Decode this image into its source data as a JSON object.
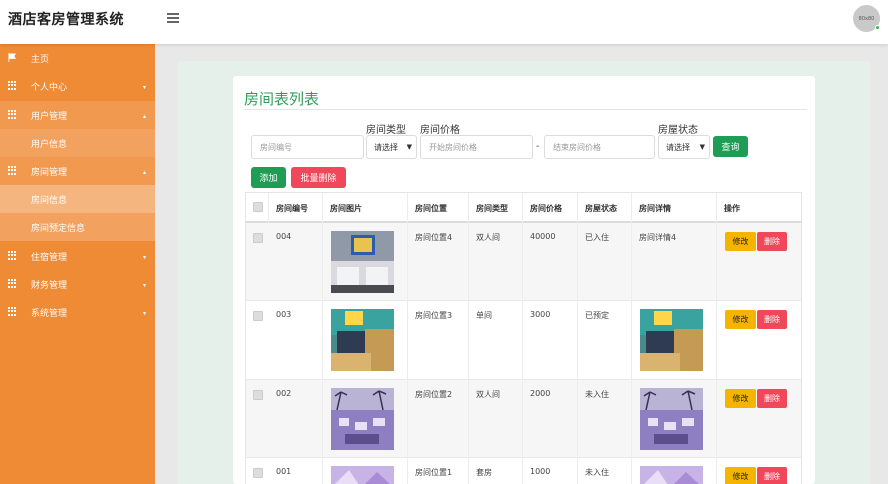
{
  "header": {
    "app_title": "酒店客房管理系统",
    "avatar_text": "80x80"
  },
  "sidebar": {
    "items": [
      {
        "label": "主页",
        "icon": "flag-icon"
      },
      {
        "label": "个人中心",
        "icon": "grid-icon"
      },
      {
        "label": "用户管理",
        "icon": "grid-icon"
      },
      {
        "label": "用户信息"
      },
      {
        "label": "房间管理",
        "icon": "grid-icon"
      },
      {
        "label": "房间信息"
      },
      {
        "label": "房间预定信息"
      },
      {
        "label": "住宿管理",
        "icon": "grid-icon"
      },
      {
        "label": "财务管理",
        "icon": "grid-icon"
      },
      {
        "label": "系统管理",
        "icon": "grid-icon"
      }
    ]
  },
  "panel": {
    "title": "房间表列表"
  },
  "filters": {
    "room_number_placeholder": "房间编号",
    "room_type_label": "房间类型",
    "room_type_value": "请选择",
    "room_price_label": "房间价格",
    "price_start_placeholder": "开始房间价格",
    "price_separator": "-",
    "price_end_placeholder": "结束房间价格",
    "room_status_label": "房屋状态",
    "room_status_value": "请选择",
    "query_button": "查询",
    "add_button": "添加",
    "batch_delete_button": "批量删除"
  },
  "table": {
    "headers": [
      "房间编号",
      "房间图片",
      "房间位置",
      "房间类型",
      "房间价格",
      "房屋状态",
      "房间详情",
      "操作"
    ],
    "edit_label": "修改",
    "delete_label": "删除",
    "rows": [
      {
        "number": "004",
        "location": "房间位置4",
        "type": "双人间",
        "price": "40000",
        "status": "已入住",
        "detail": "房间详情4",
        "detail_is_image": false
      },
      {
        "number": "003",
        "location": "房间位置3",
        "type": "单间",
        "price": "3000",
        "status": "已预定",
        "detail": "",
        "detail_is_image": true
      },
      {
        "number": "002",
        "location": "房间位置2",
        "type": "双人间",
        "price": "2000",
        "status": "未入住",
        "detail": "",
        "detail_is_image": true
      },
      {
        "number": "001",
        "location": "房间位置1",
        "type": "套房",
        "price": "1000",
        "status": "未入住",
        "detail": "",
        "detail_is_image": true
      }
    ]
  },
  "colors": {
    "sidebar": "#ef8a35",
    "accent_green": "#1f9d55",
    "danger": "#f0485a",
    "warning": "#f4b400"
  }
}
